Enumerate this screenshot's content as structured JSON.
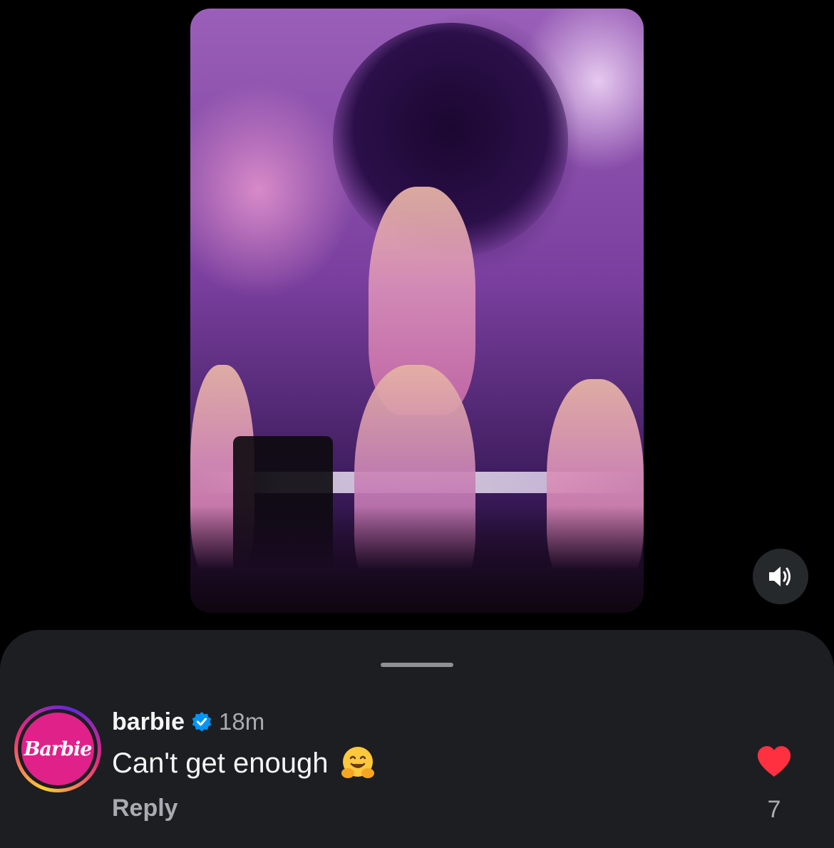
{
  "video": {
    "description_icon": "concert-video-thumbnail",
    "mute_icon": "speaker-volume-icon"
  },
  "comment": {
    "avatar_text": "Barbie",
    "username": "barbie",
    "verified_icon": "verified-badge-icon",
    "timestamp": "18m",
    "text": "Can't get enough",
    "emoji_icon": "hugging-face-emoji",
    "reply_label": "Reply",
    "like_icon": "heart-filled-icon",
    "like_count": "7"
  },
  "colors": {
    "background": "#000000",
    "sheet": "#1c1e21",
    "text_primary": "#f5f5f5",
    "text_secondary": "#a8acb2",
    "verified_blue": "#0095f6",
    "like_red": "#ff3040",
    "barbie_pink": "#e0218a"
  }
}
